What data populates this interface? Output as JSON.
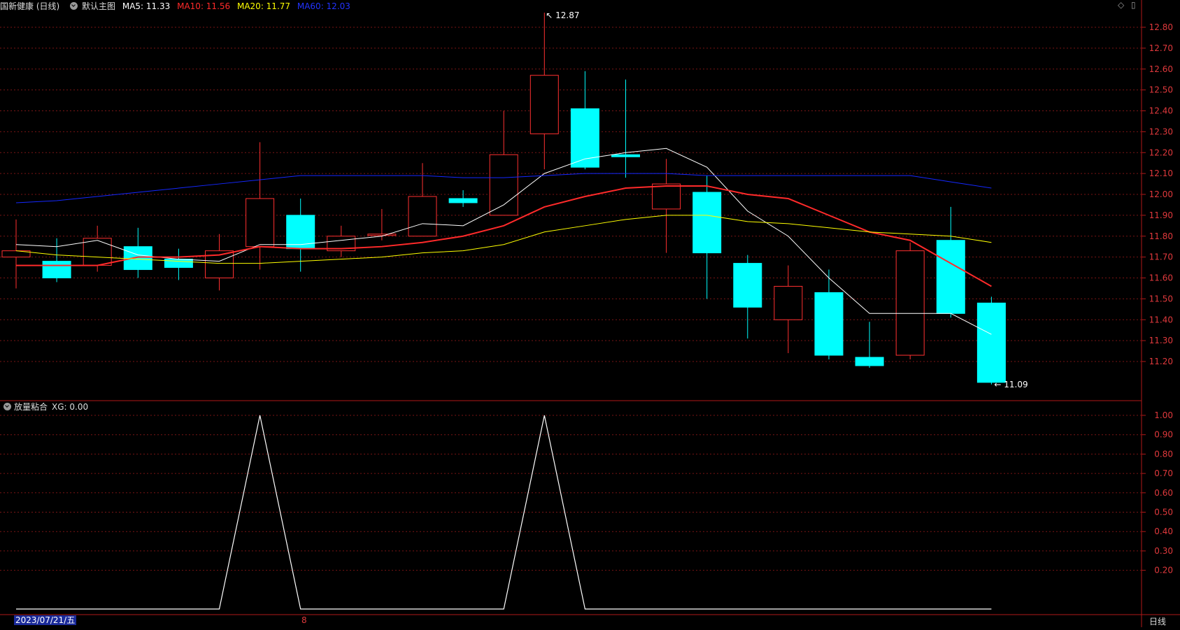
{
  "header": {
    "title": "国新健康 (日线)",
    "main_chart_label": "默认主图",
    "ma_items": [
      {
        "label": "MA5: 11.33",
        "color": "#ffffff"
      },
      {
        "label": "MA10: 11.56",
        "color": "#ff2a2a"
      },
      {
        "label": "MA20: 11.77",
        "color": "#ffff00"
      },
      {
        "label": "MA60: 12.03",
        "color": "#2233ff"
      }
    ],
    "window_icons": [
      "diamond-icon",
      "restore-icon"
    ]
  },
  "sub_header": {
    "label": "放量粘合",
    "value_label": "XG: 0.00"
  },
  "footer": {
    "date": "2023/07/21/五",
    "marker": "8",
    "period": "日线"
  },
  "annotations": {
    "high": "12.87",
    "low": "11.09"
  },
  "colors": {
    "up": "#ff3030",
    "down": "#00ffff",
    "grid": "#7a1515",
    "axis_text": "#e0393c",
    "ma5": "#ffffff",
    "ma10": "#ff2a2a",
    "ma20": "#ffff00",
    "ma60": "#1428ff",
    "indicator": "#ffffff"
  },
  "chart_data": [
    {
      "type": "candlestick",
      "title": "",
      "ylim": [
        11.05,
        12.88
      ],
      "yticks": [
        11.2,
        11.3,
        11.4,
        11.5,
        11.6,
        11.7,
        11.8,
        11.9,
        12.0,
        12.1,
        12.2,
        12.3,
        12.4,
        12.5,
        12.6,
        12.7,
        12.8
      ],
      "candles": [
        {
          "o": 11.7,
          "h": 11.88,
          "l": 11.55,
          "c": 11.73
        },
        {
          "o": 11.68,
          "h": 11.79,
          "l": 11.58,
          "c": 11.6
        },
        {
          "o": 11.66,
          "h": 11.85,
          "l": 11.63,
          "c": 11.79
        },
        {
          "o": 11.75,
          "h": 11.84,
          "l": 11.6,
          "c": 11.64
        },
        {
          "o": 11.69,
          "h": 11.74,
          "l": 11.59,
          "c": 11.65
        },
        {
          "o": 11.6,
          "h": 11.81,
          "l": 11.54,
          "c": 11.73
        },
        {
          "o": 11.75,
          "h": 12.25,
          "l": 11.64,
          "c": 11.98
        },
        {
          "o": 11.9,
          "h": 11.98,
          "l": 11.63,
          "c": 11.74
        },
        {
          "o": 11.73,
          "h": 11.85,
          "l": 11.7,
          "c": 11.8
        },
        {
          "o": 11.81,
          "h": 11.93,
          "l": 11.78,
          "c": 11.81
        },
        {
          "o": 11.8,
          "h": 12.15,
          "l": 11.8,
          "c": 11.99
        },
        {
          "o": 11.98,
          "h": 12.02,
          "l": 11.94,
          "c": 11.96
        },
        {
          "o": 11.9,
          "h": 12.4,
          "l": 11.9,
          "c": 12.19
        },
        {
          "o": 12.29,
          "h": 12.87,
          "l": 12.12,
          "c": 12.57
        },
        {
          "o": 12.41,
          "h": 12.59,
          "l": 12.12,
          "c": 12.13
        },
        {
          "o": 12.19,
          "h": 12.55,
          "l": 12.08,
          "c": 12.18
        },
        {
          "o": 11.93,
          "h": 12.17,
          "l": 11.72,
          "c": 12.05
        },
        {
          "o": 12.01,
          "h": 12.09,
          "l": 11.5,
          "c": 11.72
        },
        {
          "o": 11.67,
          "h": 11.71,
          "l": 11.31,
          "c": 11.46
        },
        {
          "o": 11.4,
          "h": 11.66,
          "l": 11.24,
          "c": 11.56
        },
        {
          "o": 11.53,
          "h": 11.64,
          "l": 11.21,
          "c": 11.23
        },
        {
          "o": 11.22,
          "h": 11.39,
          "l": 11.17,
          "c": 11.18
        },
        {
          "o": 11.23,
          "h": 11.77,
          "l": 11.21,
          "c": 11.73
        },
        {
          "o": 11.78,
          "h": 11.94,
          "l": 11.41,
          "c": 11.43
        },
        {
          "o": 11.48,
          "h": 11.51,
          "l": 11.09,
          "c": 11.1
        }
      ],
      "series": [
        {
          "name": "MA5",
          "values": [
            11.76,
            11.75,
            11.78,
            11.71,
            11.69,
            11.68,
            11.76,
            11.76,
            11.78,
            11.8,
            11.86,
            11.85,
            11.95,
            12.1,
            12.17,
            12.2,
            12.22,
            12.13,
            11.92,
            11.8,
            11.6,
            11.43,
            11.43,
            11.43,
            11.33
          ]
        },
        {
          "name": "MA10",
          "values": [
            11.66,
            11.66,
            11.66,
            11.7,
            11.7,
            11.71,
            11.75,
            11.74,
            11.74,
            11.75,
            11.77,
            11.8,
            11.85,
            11.94,
            11.99,
            12.03,
            12.04,
            12.04,
            12.0,
            11.98,
            11.9,
            11.82,
            11.78,
            11.67,
            11.56
          ]
        },
        {
          "name": "MA20",
          "values": [
            11.73,
            11.71,
            11.7,
            11.69,
            11.68,
            11.67,
            11.67,
            11.68,
            11.69,
            11.7,
            11.72,
            11.73,
            11.76,
            11.82,
            11.85,
            11.88,
            11.9,
            11.9,
            11.87,
            11.86,
            11.84,
            11.82,
            11.81,
            11.8,
            11.77
          ]
        },
        {
          "name": "MA60",
          "values": [
            11.96,
            11.97,
            11.99,
            12.01,
            12.03,
            12.05,
            12.07,
            12.09,
            12.09,
            12.09,
            12.09,
            12.08,
            12.08,
            12.09,
            12.1,
            12.1,
            12.1,
            12.09,
            12.09,
            12.09,
            12.09,
            12.09,
            12.09,
            12.06,
            12.03
          ]
        }
      ]
    },
    {
      "type": "line",
      "title": "",
      "ylim": [
        0,
        1.06
      ],
      "yticks": [
        0.2,
        0.3,
        0.4,
        0.5,
        0.6,
        0.7,
        0.8,
        0.9,
        1.0
      ],
      "series": [
        {
          "name": "XG",
          "values": [
            0,
            0,
            0,
            0,
            0,
            0,
            1,
            0,
            0,
            0,
            0,
            0,
            0,
            1,
            0,
            0,
            0,
            0,
            0,
            0,
            0,
            0,
            0,
            0,
            0
          ]
        }
      ]
    }
  ]
}
